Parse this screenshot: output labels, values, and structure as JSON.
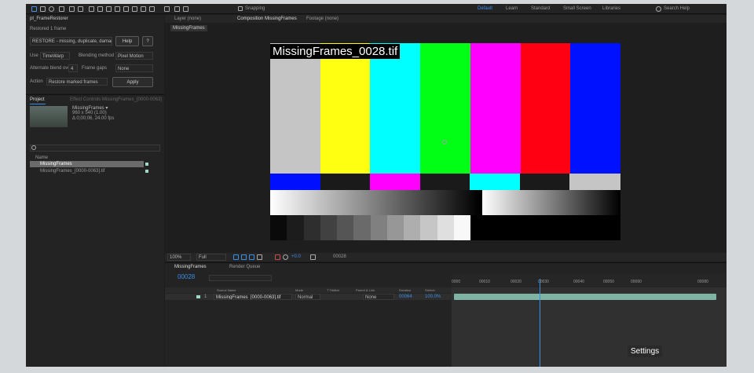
{
  "toolbar": {
    "snapping": "Snapping",
    "workspaces": [
      "Default",
      "Learn",
      "Standard",
      "Small Screen",
      "Libraries"
    ],
    "search": "Search Help"
  },
  "effect_panel": {
    "title": "pt_FrameRestorer",
    "subtitle": "Restored 1 frame",
    "mode": "RESTORE - missing, duplicate, damaged",
    "help": "Help",
    "question": "?",
    "use_label": "Use",
    "use_value": "TimeWarp",
    "blend_label": "Blending method",
    "blend_value": "Pixel Motion",
    "alt_label": "Alternate blend over",
    "alt_value": "4",
    "gaps_label": "Frame gaps",
    "gaps_value": "None",
    "action_label": "Action",
    "action_value": "Restore marked frames",
    "apply": "Apply"
  },
  "project": {
    "tab": "Project",
    "effect_controls": "Effect Controls MissingFrames_[0000-0063]",
    "thumb_name": "MissingFrames ▾",
    "thumb_info1": "960 x 540 (1.00)",
    "thumb_info2": "Δ 0;00;06, 24.00 fps",
    "col_name": "Name",
    "items": [
      "MissingFrames",
      "MissingFrames_[0000-0063].tif"
    ]
  },
  "viewer": {
    "tabs": [
      "Layer (none)",
      "Composition MissingFrames",
      "Footage (none)"
    ],
    "comp_chip": "MissingFrames",
    "filename": "MissingFrames_0028.tif",
    "zoom": "100%",
    "quality": "Full",
    "exposure": "+0.0",
    "timecode": "00028"
  },
  "timeline": {
    "tab": "MissingFrames",
    "render_queue": "Render Queue",
    "current": "00028",
    "headers": [
      "Source Name",
      "Mode",
      "T TrkMat",
      "Parent & Link",
      "Duration",
      "Stretch"
    ],
    "layer_num": "1",
    "layer_name": "MissingFrames_[0000-0063].tif",
    "layer_mode": "Normal",
    "layer_parent": "None",
    "layer_duration": "00064",
    "layer_stretch": "100.0%",
    "ruler": [
      "0000",
      "00010",
      "00020",
      "00030",
      "00040",
      "00050",
      "00060",
      "00080"
    ]
  },
  "tooltip": "Settings",
  "colors": {
    "bars_top": [
      "#c5c5c5",
      "#ffff12",
      "#00ffff",
      "#00ff14",
      "#ff00ff",
      "#ff0012",
      "#0011ff"
    ],
    "accent": "#3a8ee6"
  }
}
